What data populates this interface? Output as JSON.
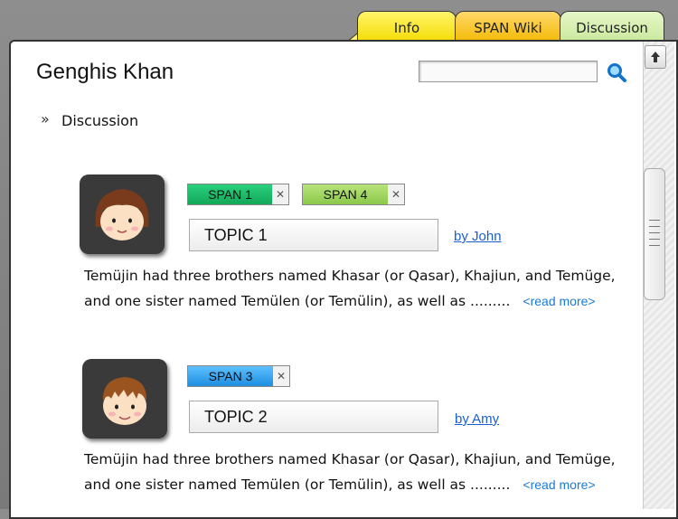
{
  "tabs": [
    {
      "label": "Info"
    },
    {
      "label": "SPAN Wiki"
    },
    {
      "label": "Discussion",
      "active": true
    }
  ],
  "page": {
    "title": "Genghis Khan"
  },
  "search": {
    "value": "",
    "placeholder": ""
  },
  "breadcrumb": {
    "icon": "double-chevron-right-icon",
    "label": "Discussion"
  },
  "posts": [
    {
      "avatar": "girl-avatar-icon",
      "tags": [
        {
          "label": "SPAN 1",
          "color": "#1eb86a"
        },
        {
          "label": "SPAN 4",
          "color": "#9fd65a"
        }
      ],
      "topic": "TOPIC 1",
      "author": "by John",
      "body": "Temüjin had three brothers named Khasar (or Qasar), Khajiun, and Temüge, and one sister named Temülen (or Temülin), as well as .........",
      "read_more": "<read more>"
    },
    {
      "avatar": "boy-avatar-icon",
      "tags": [
        {
          "label": "SPAN 3",
          "color": "#3aa4ea"
        }
      ],
      "topic": "TOPIC 2",
      "author": "by Amy",
      "body": "Temüjin had three brothers named Khasar (or Qasar), Khajiun, and Temüge, and one sister named Temülen (or Temülin), as well as .........",
      "read_more": "<read more>"
    }
  ],
  "colors": {
    "tab_info": "#f7e51c",
    "tab_wiki": "#f5c42a",
    "tab_discussion": "#d3ecad",
    "link": "#1a5fd0"
  }
}
